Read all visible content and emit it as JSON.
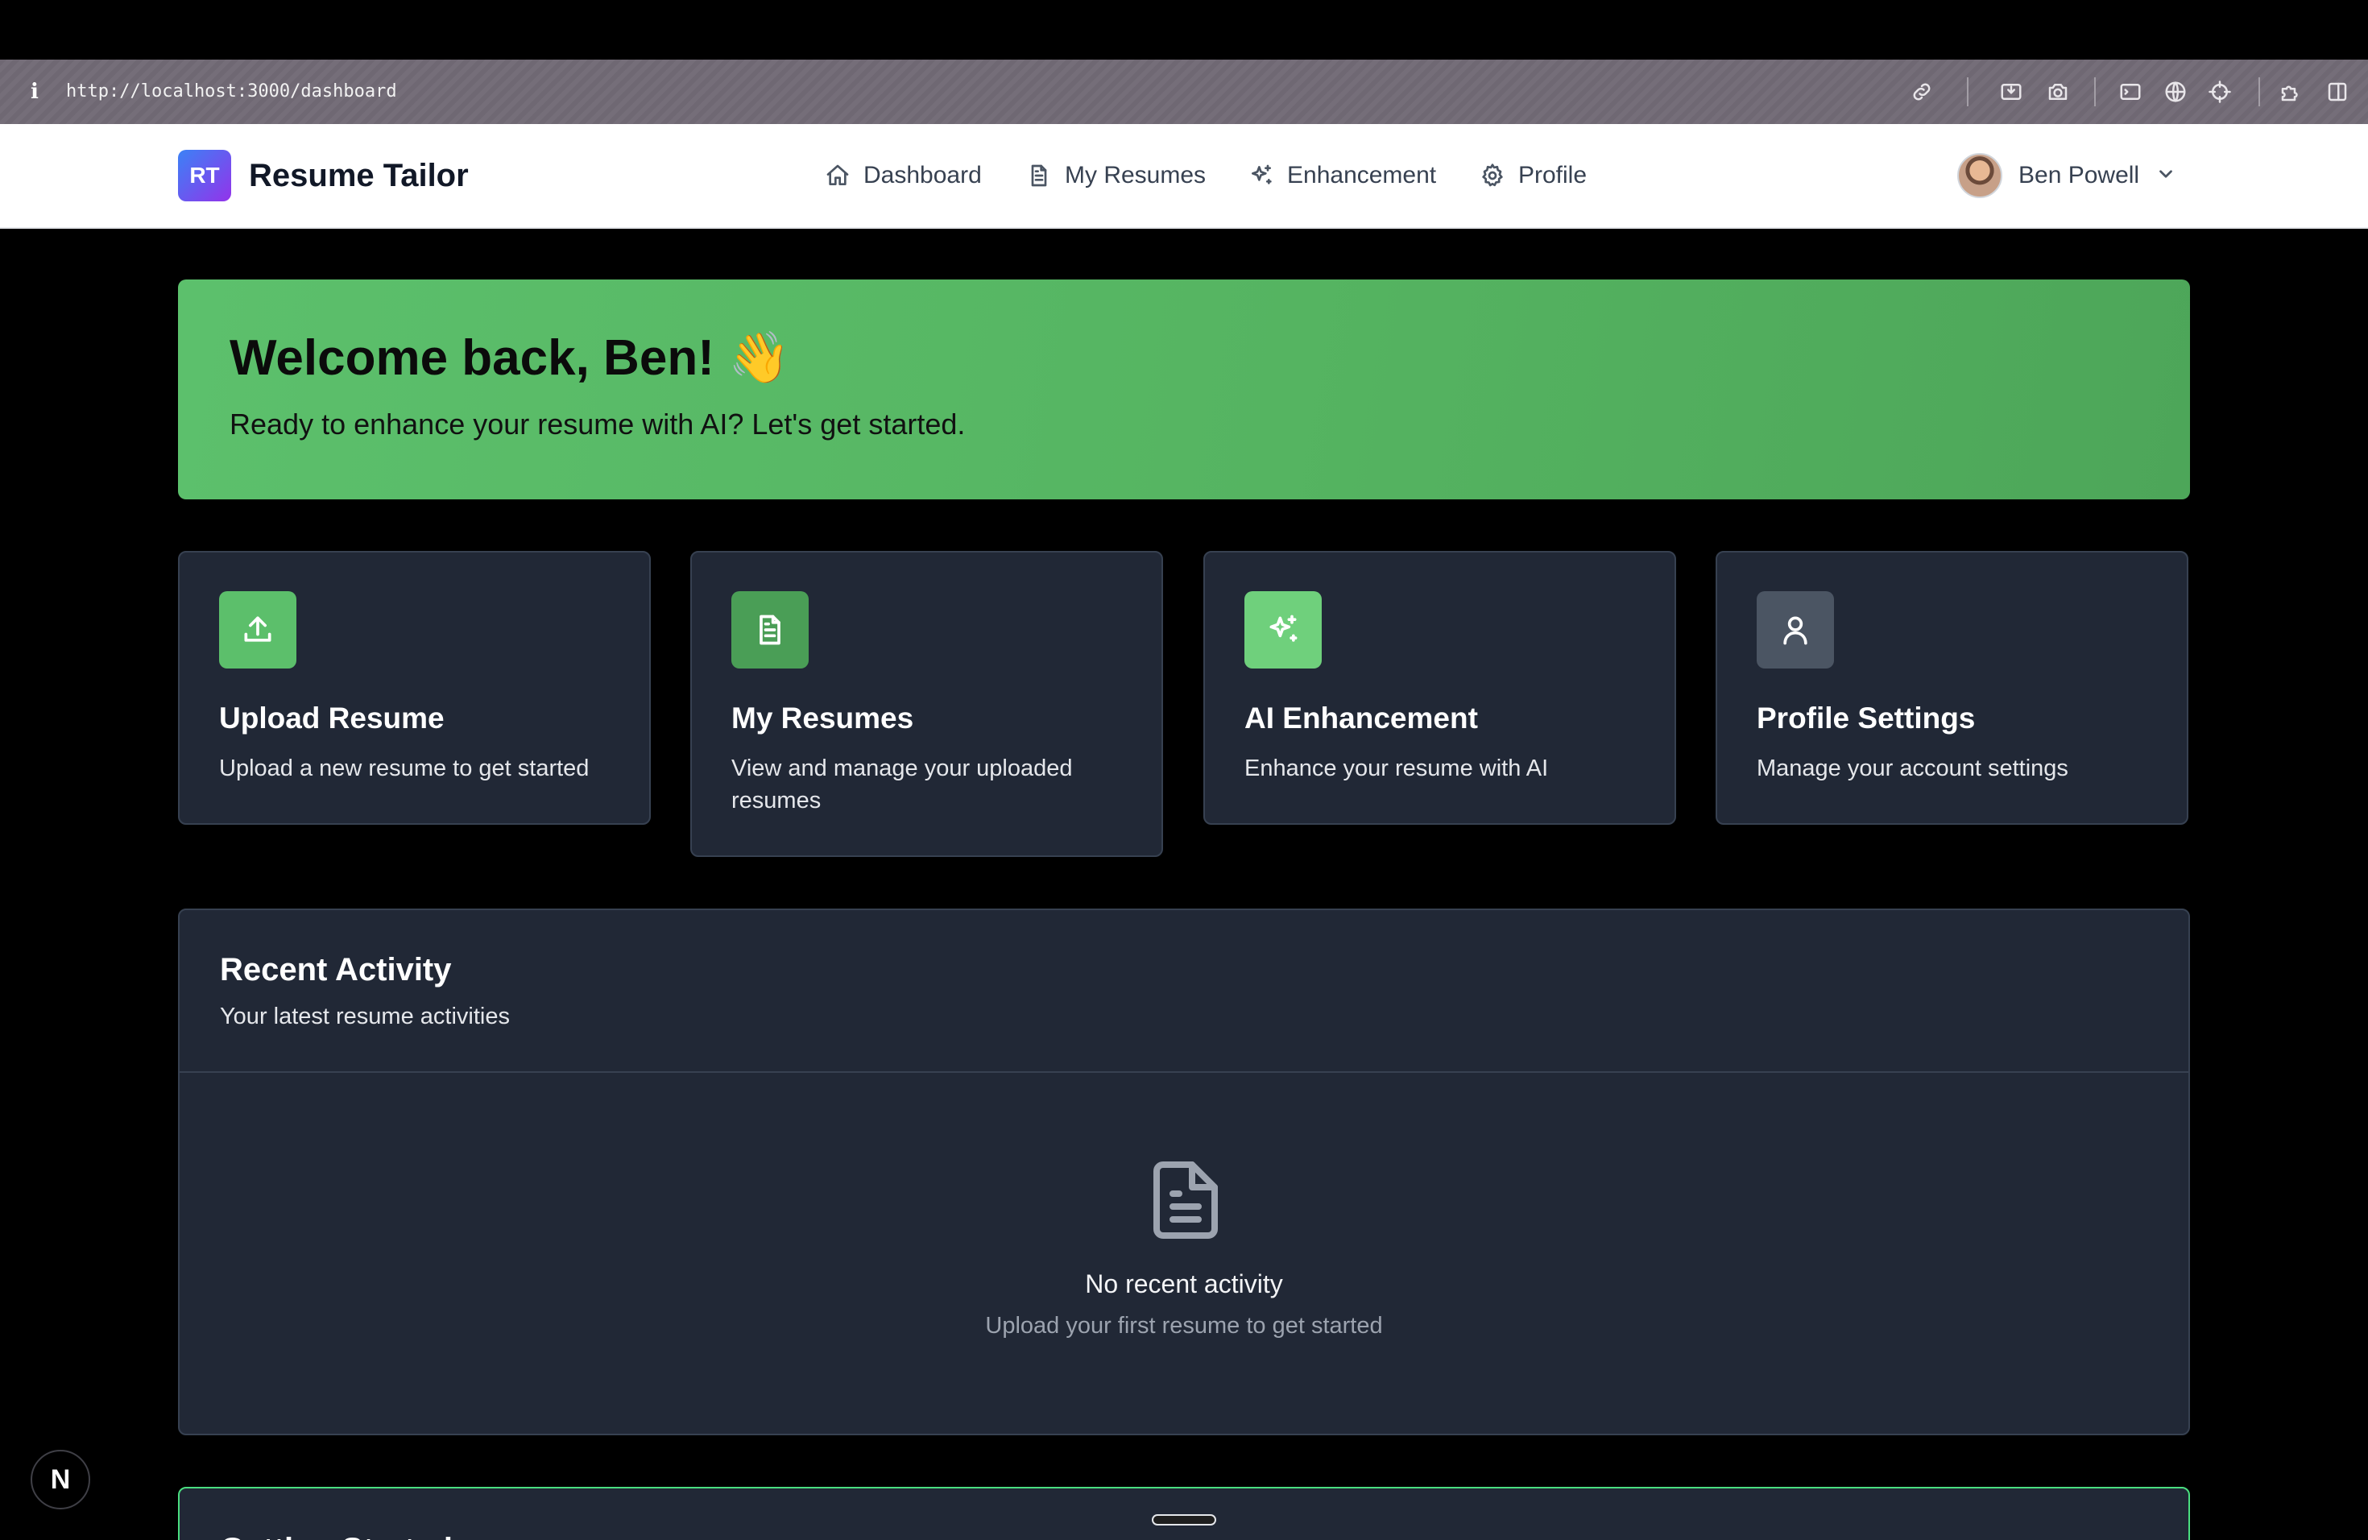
{
  "browser": {
    "url": "http://localhost:3000/dashboard",
    "tools": [
      "link-icon",
      "screenshot-icon",
      "camera-icon",
      "terminal-icon",
      "globe-icon",
      "crosshair-icon",
      "extensions-icon",
      "split-view-icon"
    ]
  },
  "header": {
    "logo_text": "RT",
    "brand": "Resume Tailor",
    "nav": [
      {
        "label": "Dashboard",
        "icon": "home-icon"
      },
      {
        "label": "My Resumes",
        "icon": "document-icon"
      },
      {
        "label": "Enhancement",
        "icon": "sparkles-icon"
      },
      {
        "label": "Profile",
        "icon": "gear-icon"
      }
    ],
    "user": {
      "name": "Ben Powell"
    }
  },
  "welcome": {
    "title": "Welcome back, Ben! 👋",
    "subtitle": "Ready to enhance your resume with AI? Let's get started."
  },
  "cards": [
    {
      "title": "Upload Resume",
      "description": "Upload a new resume to get started",
      "icon": "upload-icon",
      "color": "#5cbf6b"
    },
    {
      "title": "My Resumes",
      "description": "View and manage your uploaded resumes",
      "icon": "document-icon",
      "color": "#4a9e56"
    },
    {
      "title": "AI Enhancement",
      "description": "Enhance your resume with AI",
      "icon": "sparkles-icon",
      "color": "#6fd07c"
    },
    {
      "title": "Profile Settings",
      "description": "Manage your account settings",
      "icon": "user-icon",
      "color": "#4b5563"
    }
  ],
  "activity": {
    "title": "Recent Activity",
    "subtitle": "Your latest resume activities",
    "empty_title": "No recent activity",
    "empty_subtitle": "Upload your first resume to get started"
  },
  "next_section": {
    "title": "Getting Started"
  },
  "dev_badge": "N"
}
